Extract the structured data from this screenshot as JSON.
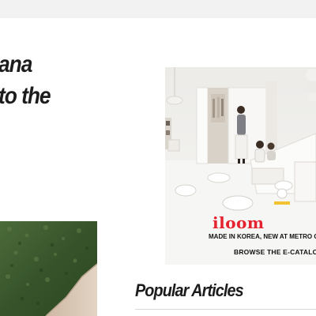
{
  "article": {
    "headline_line1": "ana",
    "headline_line2": "to the"
  },
  "ad": {
    "brand": "iloom",
    "tagline": "MADE IN KOREA, NEW AT METRO C",
    "cta": "BROWSE THE E-CATALO"
  },
  "sidebar": {
    "popular_title": "Popular Articles"
  },
  "colors": {
    "topbar": "#f2f2f2",
    "headline": "#1c1c1c",
    "brand_red": "#e4232f"
  }
}
